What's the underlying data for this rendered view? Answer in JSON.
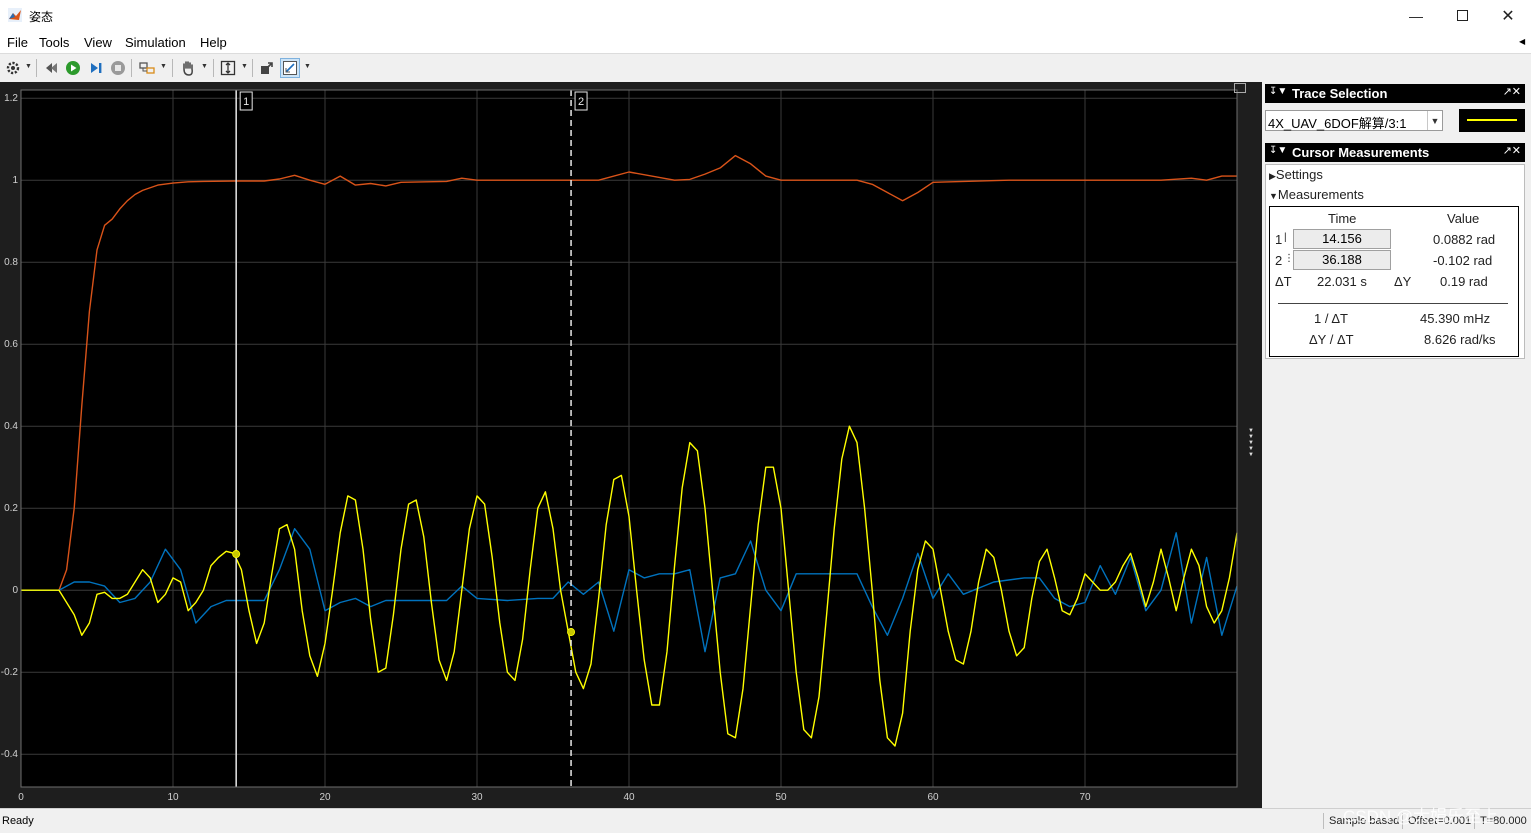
{
  "window": {
    "title": "姿态"
  },
  "menu": [
    "File",
    "Tools",
    "View",
    "Simulation",
    "Help"
  ],
  "icons": {
    "toolbar": [
      "gear-icon",
      "step-back-icon",
      "run-icon",
      "step-forward-icon",
      "stop-icon",
      "highlight-icon",
      "pan-icon",
      "zoom-fit-icon",
      "export-icon",
      "cursor-measure-icon"
    ]
  },
  "colors": {
    "accent": "#2b7fd6",
    "trace_yellow": "#ffff00",
    "trace_blue": "#0072bd",
    "trace_orange": "#d95319"
  },
  "trace_selection": {
    "title": "Trace Selection",
    "selected": "4X_UAV_6DOF解算/3:1"
  },
  "cursor_measurements": {
    "title": "Cursor Measurements",
    "settings_label": "Settings",
    "measurements_label": "Measurements",
    "col_time": "Time",
    "col_value": "Value",
    "row1_label": "1",
    "row1_time": "14.156",
    "row1_value": "0.0882 rad",
    "row2_label": "2",
    "row2_time": "36.188",
    "row2_value": "-0.102 rad",
    "dt_label": "ΔT",
    "dt_value": "22.031 s",
    "dy_label": "ΔY",
    "dy_value": "0.19 rad",
    "inv_dt_label": "1 / ΔT",
    "inv_dt_value": "45.390 mHz",
    "slope_label": "ΔY / ΔT",
    "slope_value": "8.626 rad/ks"
  },
  "status": {
    "ready": "Ready",
    "sample": "Sample based",
    "offset": "Offset=0.001",
    "t": "T=80.000"
  },
  "watermark": "CSDN @大娟乐至上",
  "chart_data": {
    "type": "line",
    "xlim": [
      0,
      80
    ],
    "ylim": [
      -0.48,
      1.22
    ],
    "xticks": [
      0,
      10,
      20,
      30,
      40,
      50,
      60,
      70
    ],
    "yticks": [
      -0.4,
      -0.2,
      0,
      0.2,
      0.4,
      0.6,
      0.8,
      1,
      1.2
    ],
    "xtick_labels": [
      "0",
      "10",
      "20",
      "30",
      "40",
      "50",
      "60",
      "70"
    ],
    "ytick_labels": [
      "-0.4",
      "-0.2",
      "0",
      "0.2",
      "0.4",
      "0.6",
      "0.8",
      "1",
      "1.2"
    ],
    "grid": true,
    "cursors": [
      {
        "label": "1",
        "x": 14.156,
        "y": 0.0882,
        "style": "solid"
      },
      {
        "label": "2",
        "x": 36.188,
        "y": -0.102,
        "style": "dashed"
      }
    ],
    "series": [
      {
        "color": "#d95319",
        "x": [
          0,
          2.5,
          3,
          3.5,
          4,
          4.5,
          5,
          5.5,
          6,
          6.5,
          7,
          7.5,
          8,
          9,
          10,
          11,
          12,
          14,
          16,
          17,
          18,
          19,
          20,
          21,
          22,
          23,
          24,
          25,
          28,
          29,
          30,
          35,
          38,
          40,
          43,
          44,
          45,
          46,
          47,
          48,
          49,
          50,
          55,
          56,
          57,
          58,
          59,
          60,
          65,
          70,
          75,
          77,
          78,
          79,
          80
        ],
        "y": [
          0,
          0,
          0.05,
          0.2,
          0.45,
          0.68,
          0.83,
          0.89,
          0.905,
          0.93,
          0.95,
          0.965,
          0.975,
          0.988,
          0.993,
          0.996,
          0.997,
          0.998,
          0.998,
          1.003,
          1.012,
          1.0,
          0.99,
          1.01,
          0.988,
          0.992,
          0.986,
          0.995,
          0.997,
          1.005,
          1.0,
          1.0,
          1.0,
          1.02,
          1.0,
          1.002,
          1.015,
          1.03,
          1.06,
          1.04,
          1.01,
          1.0,
          1.0,
          0.99,
          0.97,
          0.95,
          0.97,
          0.995,
          1.0,
          1.0,
          1.0,
          1.005,
          1.0,
          1.01,
          1.01
        ]
      },
      {
        "color": "#0072bd",
        "x": [
          0,
          2.5,
          3.5,
          4.5,
          5.5,
          6.5,
          7.5,
          8.5,
          9.5,
          10.5,
          11.5,
          12.5,
          13.5,
          14.5,
          16,
          17,
          18,
          19,
          20,
          21,
          22,
          23,
          24,
          25,
          28,
          29,
          30,
          32,
          34,
          35,
          36,
          37,
          38,
          39,
          40,
          41,
          42,
          43,
          44,
          45,
          46,
          47,
          48,
          49,
          50,
          51,
          52,
          53,
          54,
          55,
          56,
          57,
          58,
          59,
          60,
          61,
          62,
          64,
          66,
          67,
          68,
          69,
          70,
          71,
          72,
          73,
          74,
          75,
          76,
          77,
          78,
          79,
          80
        ],
        "y": [
          0,
          0,
          0.02,
          0.02,
          0.01,
          -0.03,
          -0.02,
          0.02,
          0.1,
          0.05,
          -0.08,
          -0.04,
          -0.025,
          -0.025,
          -0.025,
          0.05,
          0.15,
          0.1,
          -0.05,
          -0.03,
          -0.02,
          -0.04,
          -0.025,
          -0.025,
          -0.025,
          0.01,
          -0.02,
          -0.025,
          -0.02,
          -0.02,
          0.02,
          -0.01,
          0.02,
          -0.1,
          0.05,
          0.03,
          0.04,
          0.04,
          0.05,
          -0.15,
          0.03,
          0.04,
          0.12,
          0.0,
          -0.05,
          0.04,
          0.04,
          0.04,
          0.04,
          0.04,
          -0.04,
          -0.11,
          -0.02,
          0.09,
          -0.02,
          0.04,
          -0.01,
          0.02,
          0.03,
          0.03,
          -0.02,
          -0.04,
          -0.03,
          0.06,
          -0.01,
          0.08,
          -0.05,
          0.0,
          0.14,
          -0.08,
          0.08,
          -0.11,
          0.01
        ]
      },
      {
        "color": "#ffff00",
        "x": [
          0,
          2.5,
          3.5,
          4,
          4.5,
          5,
          5.5,
          6,
          6.5,
          7,
          8,
          8.5,
          9,
          9.5,
          10,
          10.5,
          11,
          11.5,
          12,
          12.5,
          13,
          13.5,
          14,
          14.5,
          15,
          15.5,
          16,
          16.5,
          17,
          17.5,
          18,
          18.5,
          19,
          19.5,
          20,
          20.5,
          21,
          21.5,
          22,
          22.5,
          23,
          23.5,
          24,
          24.5,
          25,
          25.5,
          26,
          26.5,
          27,
          27.5,
          28,
          28.5,
          29,
          29.5,
          30,
          30.5,
          31,
          31.5,
          32,
          32.5,
          33,
          33.5,
          34,
          34.5,
          35,
          35.5,
          36,
          36.5,
          37,
          37.5,
          38,
          38.5,
          39,
          39.5,
          40,
          40.5,
          41,
          41.5,
          42,
          42.5,
          43,
          43.5,
          44,
          44.5,
          45,
          45.5,
          46,
          46.5,
          47,
          47.5,
          48,
          48.5,
          49,
          49.5,
          50,
          50.5,
          51,
          51.5,
          52,
          52.5,
          53,
          53.5,
          54,
          54.5,
          55,
          55.5,
          56,
          56.5,
          57,
          57.5,
          58,
          58.5,
          59,
          59.5,
          60,
          60.5,
          61,
          61.5,
          62,
          62.5,
          63,
          63.5,
          64,
          64.5,
          65,
          65.5,
          66,
          66.5,
          67,
          67.5,
          68,
          68.5,
          69,
          69.5,
          70,
          70.5,
          71,
          71.5,
          72,
          72.5,
          73,
          73.5,
          74,
          74.5,
          75,
          75.5,
          76,
          76.5,
          77,
          77.5,
          78,
          78.5,
          79,
          79.5,
          80
        ],
        "y": [
          0,
          0,
          -0.06,
          -0.11,
          -0.08,
          -0.01,
          -0.005,
          -0.02,
          -0.02,
          -0.01,
          0.05,
          0.03,
          -0.03,
          -0.01,
          0.03,
          0.02,
          -0.05,
          -0.03,
          0.0,
          0.06,
          0.08,
          0.095,
          0.09,
          0.05,
          -0.05,
          -0.13,
          -0.08,
          0.04,
          0.15,
          0.16,
          0.1,
          -0.05,
          -0.16,
          -0.21,
          -0.13,
          0.0,
          0.14,
          0.23,
          0.22,
          0.1,
          -0.07,
          -0.2,
          -0.19,
          -0.06,
          0.1,
          0.21,
          0.22,
          0.13,
          -0.03,
          -0.17,
          -0.22,
          -0.15,
          0.0,
          0.15,
          0.23,
          0.21,
          0.08,
          -0.08,
          -0.2,
          -0.22,
          -0.12,
          0.05,
          0.2,
          0.24,
          0.15,
          0.0,
          -0.1,
          -0.2,
          -0.24,
          -0.18,
          -0.02,
          0.16,
          0.27,
          0.28,
          0.18,
          0.0,
          -0.17,
          -0.28,
          -0.28,
          -0.15,
          0.06,
          0.25,
          0.36,
          0.34,
          0.2,
          0.0,
          -0.2,
          -0.35,
          -0.36,
          -0.24,
          -0.04,
          0.16,
          0.3,
          0.3,
          0.2,
          0.0,
          -0.2,
          -0.34,
          -0.36,
          -0.26,
          -0.06,
          0.15,
          0.32,
          0.4,
          0.36,
          0.2,
          0.0,
          -0.22,
          -0.36,
          -0.38,
          -0.3,
          -0.1,
          0.05,
          0.12,
          0.1,
          0.0,
          -0.1,
          -0.17,
          -0.18,
          -0.1,
          0.02,
          0.1,
          0.08,
          0.0,
          -0.1,
          -0.16,
          -0.14,
          -0.02,
          0.07,
          0.1,
          0.03,
          -0.05,
          -0.06,
          -0.02,
          0.04,
          0.02,
          0.0,
          0.0,
          0.02,
          0.06,
          0.09,
          0.03,
          -0.04,
          0.02,
          0.1,
          0.03,
          -0.05,
          0.03,
          0.1,
          0.06,
          -0.04,
          -0.08,
          -0.05,
          0.03,
          0.14
        ]
      }
    ]
  }
}
